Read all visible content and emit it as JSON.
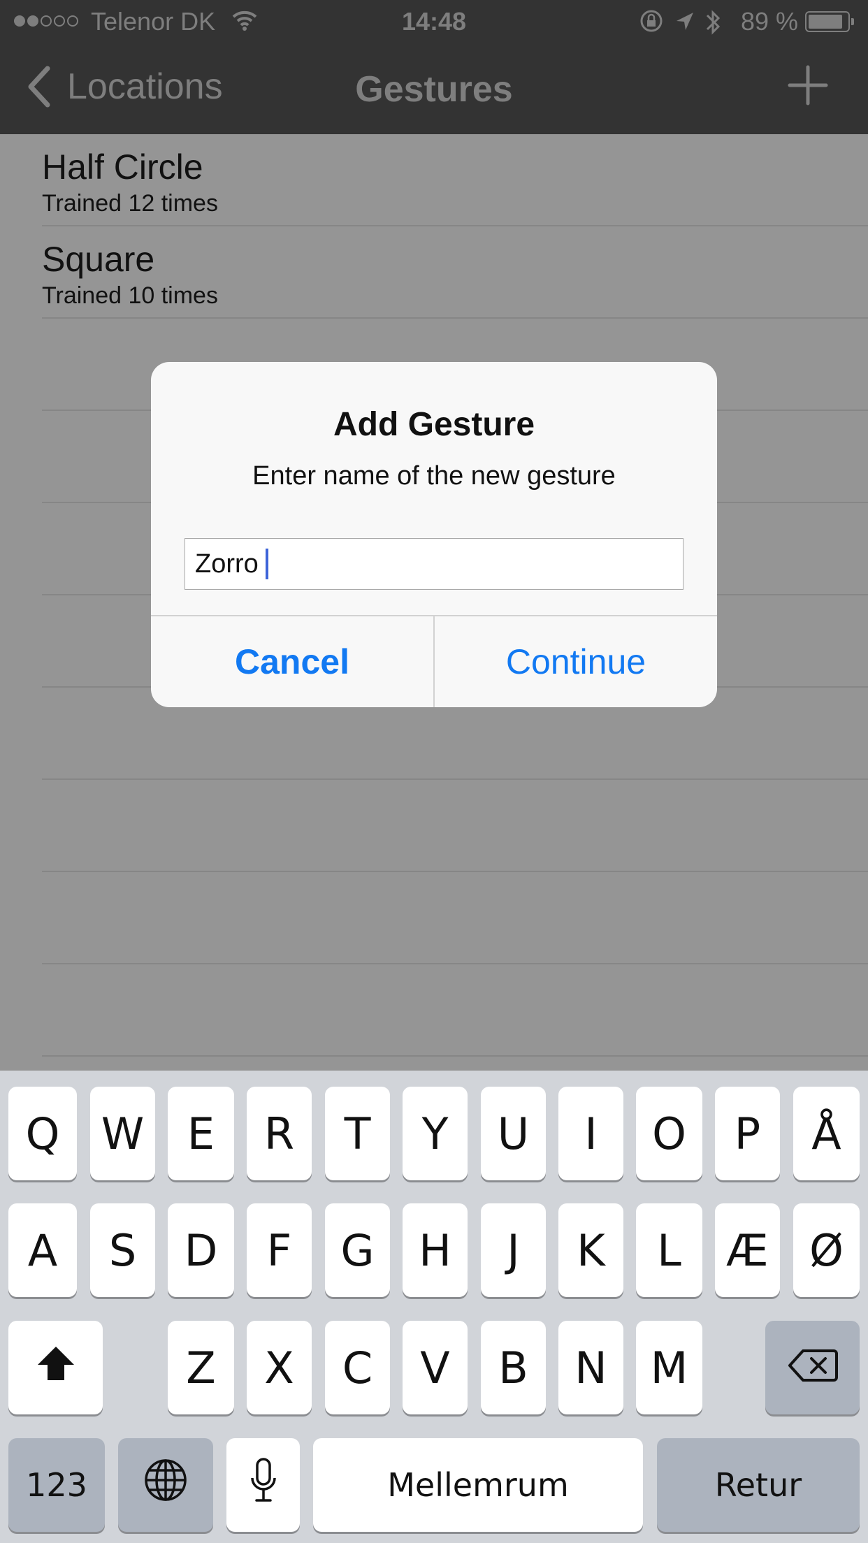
{
  "status_bar": {
    "signal_full": 2,
    "signal_total": 5,
    "carrier": "Telenor DK",
    "time": "14:48",
    "battery_percent_label": "89 %",
    "battery_level": 0.89,
    "icons": [
      "wifi-icon",
      "orientation-lock-icon",
      "location-arrow-icon",
      "bluetooth-icon",
      "battery-icon"
    ]
  },
  "nav": {
    "back_label": "Locations",
    "title": "Gestures",
    "add_icon": "plus-icon"
  },
  "list": {
    "items": [
      {
        "title": "Half Circle",
        "subtitle": "Trained 12 times"
      },
      {
        "title": "Square",
        "subtitle": "Trained 10 times"
      }
    ],
    "empty_rows": 8
  },
  "alert": {
    "title": "Add Gesture",
    "message": "Enter name of the new gesture",
    "input_value": "Zorro",
    "cancel_label": "Cancel",
    "continue_label": "Continue"
  },
  "keyboard": {
    "row1": [
      "Q",
      "W",
      "E",
      "R",
      "T",
      "Y",
      "U",
      "I",
      "O",
      "P",
      "Å"
    ],
    "row2": [
      "A",
      "S",
      "D",
      "F",
      "G",
      "H",
      "J",
      "K",
      "L",
      "Æ",
      "Ø"
    ],
    "row3": [
      "Z",
      "X",
      "C",
      "V",
      "B",
      "N",
      "M"
    ],
    "numbers_label": "123",
    "space_label": "Mellemrum",
    "return_label": "Retur",
    "shift_icon": "shift-icon",
    "delete_icon": "backspace-icon",
    "globe_icon": "globe-icon",
    "mic_icon": "microphone-icon"
  },
  "colors": {
    "bar_background": "#333333",
    "dimmed_background": "#959595",
    "alert_button": "#1279f2",
    "caret": "#3d64d8",
    "keyboard_background": "#d1d4d9"
  }
}
